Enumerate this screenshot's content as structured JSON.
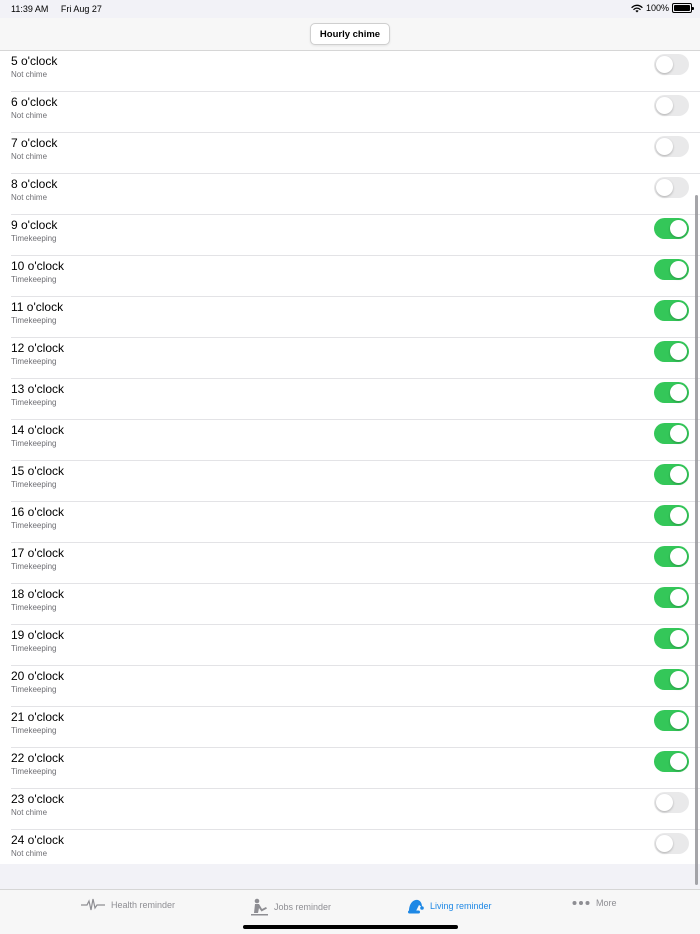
{
  "status_bar": {
    "time": "11:39 AM",
    "date": "Fri Aug 27",
    "battery": "100%"
  },
  "nav": {
    "title": "Hourly chime"
  },
  "rows": [
    {
      "title": "5 o'clock",
      "subtitle": "Not chime",
      "on": false
    },
    {
      "title": "6 o'clock",
      "subtitle": "Not chime",
      "on": false
    },
    {
      "title": "7 o'clock",
      "subtitle": "Not chime",
      "on": false
    },
    {
      "title": "8 o'clock",
      "subtitle": "Not chime",
      "on": false
    },
    {
      "title": "9 o'clock",
      "subtitle": "Timekeeping",
      "on": true
    },
    {
      "title": "10 o'clock",
      "subtitle": "Timekeeping",
      "on": true
    },
    {
      "title": "11 o'clock",
      "subtitle": "Timekeeping",
      "on": true
    },
    {
      "title": "12 o'clock",
      "subtitle": "Timekeeping",
      "on": true
    },
    {
      "title": "13 o'clock",
      "subtitle": "Timekeeping",
      "on": true
    },
    {
      "title": "14 o'clock",
      "subtitle": "Timekeeping",
      "on": true
    },
    {
      "title": "15 o'clock",
      "subtitle": "Timekeeping",
      "on": true
    },
    {
      "title": "16 o'clock",
      "subtitle": "Timekeeping",
      "on": true
    },
    {
      "title": "17 o'clock",
      "subtitle": "Timekeeping",
      "on": true
    },
    {
      "title": "18 o'clock",
      "subtitle": "Timekeeping",
      "on": true
    },
    {
      "title": "19 o'clock",
      "subtitle": "Timekeeping",
      "on": true
    },
    {
      "title": "20 o'clock",
      "subtitle": "Timekeeping",
      "on": true
    },
    {
      "title": "21 o'clock",
      "subtitle": "Timekeeping",
      "on": true
    },
    {
      "title": "22 o'clock",
      "subtitle": "Timekeeping",
      "on": true
    },
    {
      "title": "23 o'clock",
      "subtitle": "Not chime",
      "on": false
    },
    {
      "title": "24 o'clock",
      "subtitle": "Not chime",
      "on": false
    }
  ],
  "tabs": [
    {
      "label": "Health reminder",
      "icon": "heartbeat-icon",
      "active": false
    },
    {
      "label": "Jobs reminder",
      "icon": "worker-icon",
      "active": false
    },
    {
      "label": "Living reminder",
      "icon": "santa-hat-icon",
      "active": true
    },
    {
      "label": "More",
      "icon": "more-dots-icon",
      "active": false
    }
  ],
  "colors": {
    "toggle_on": "#34c759",
    "toggle_off": "#e9e9ea",
    "accent": "#1e88e5",
    "inactive": "#8e8e93"
  }
}
